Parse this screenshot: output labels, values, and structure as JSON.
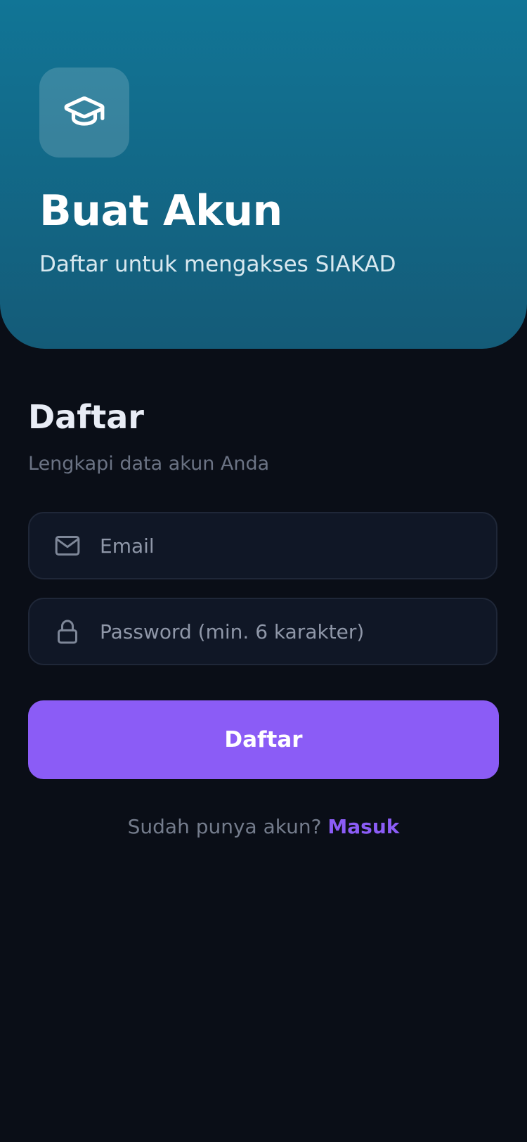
{
  "header": {
    "icon": "graduation-cap-icon",
    "title": "Buat Akun",
    "subtitle": "Daftar untuk mengakses SIAKAD",
    "gradient_top": "#117596",
    "gradient_bottom": "#145b78"
  },
  "form": {
    "title": "Daftar",
    "subtitle": "Lengkapi data akun Anda",
    "email": {
      "icon": "mail-icon",
      "value": "",
      "placeholder": "Email"
    },
    "password": {
      "icon": "lock-icon",
      "value": "",
      "placeholder": "Password (min. 6 karakter)"
    },
    "submit_label": "Daftar"
  },
  "footer": {
    "prompt": "Sudah punya akun?",
    "link_label": "Masuk"
  },
  "colors": {
    "background": "#0a0e17",
    "accent": "#8b5cf6",
    "field_background": "#101726"
  }
}
